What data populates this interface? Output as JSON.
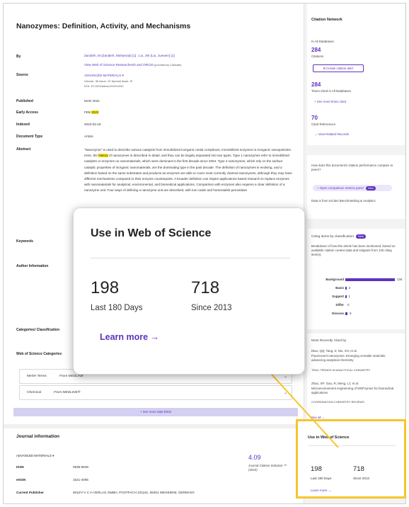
{
  "article": {
    "title": "Nanozymes: Definition, Activity, and Mechanisms",
    "by_label": "By",
    "authors_line": "Zandieh, M (Zandieh, Mohamad) [1] ; Liu, JW (Liu, Juewen) [1]",
    "researcherid_link": "View Web of Science ResearcherID and ORCID",
    "provided_by": "(provided by Clarivate)",
    "source_label": "Source",
    "source_journal": "ADVANCED MATERIALS",
    "source_details": "Volume: 36    Issue: 10    Special Issue: SI",
    "doi": "DOI: 10.1002/adma.202211041",
    "published_label": "Published",
    "published_value": "MAR 2024",
    "early_access_label": "Early Access",
    "early_access_month": "FEB",
    "early_access_year": "2023",
    "indexed_label": "Indexed",
    "indexed_value": "2023-03-18",
    "doctype_label": "Document Type",
    "doctype_value": "Article",
    "abstract_label": "Abstract",
    "abstract_pre": "\"Nanozyme\" is used to describe various catalysts from immobilized inorganic metal complexes, immobilized enzymes to inorganic nanoparticles. Here, the ",
    "abstract_hl": "history",
    "abstract_post": " of nanozymes is described in detail, and they can be largely separated into two types. Type 1 nanozymes refer to immobilized catalysts or enzymes on nanomaterials, which were dominant in the first decade since 2004. Type 2 nanozymes, which rely on the surface catalytic properties of inorganic nanomaterials, are the dominating type in the past decade. The definition of nanozymes is evolving, and a definition based on the same substrates and products as enzymes are able to cover most currently claimed nanozymes, although they may have different mechanisms compared to their enzyme counterparts. A broader definition can inspire applications based research to replace enzymes with nanomaterials for analytical, environmental, and biomedical applications. Comparison with enzymes also requires a clear definition of a nanozyme unit. Four ways of defining a nanozyme unit are described, with iron oxide and horseradish peroxidase",
    "keywords_label": "Keywords",
    "author_info_label": "Author Information",
    "categories_label": "Categories/ Classification",
    "wos_categories_label": "Web of Science Categories",
    "mesh_key": "MeSH Terms",
    "mesh_value": "From MEDLINE",
    "chemical_key": "Chemical",
    "chemical_value": "From MEDLINE®",
    "see_more": "+ See more data fields"
  },
  "journal": {
    "title": "Journal information",
    "journal_link": "ADVANCED MATERIALS",
    "issn_label": "ISSN",
    "issn_value": "0935-9648",
    "eissn_label": "eISSN",
    "eissn_value": "1521-4095",
    "publisher_label": "Current Publisher",
    "publisher_value": "WILEY-V C H VERLAG GMBH, POSTFACH 101161, 69451 WEINHEIM, GERMANY",
    "jci_value": "4.09",
    "jci_label": "Journal Citation Indicator ™ (2023)"
  },
  "sidebar": {
    "network_title": "Citation Network",
    "in_all_db": "In All Databases",
    "citations_num": "284",
    "citations_label": "Citations",
    "create_alert": "Create citation alert",
    "times_cited_num": "284",
    "times_cited_label": "Times Cited in All Databases",
    "see_more_times": "+ See more times cited",
    "cited_refs_num": "70",
    "cited_refs_label": "Cited References",
    "view_related": "→ View Related Records",
    "compare_question": "How does this document's citation performance compare to peers?",
    "open_panel": "Open comparison metrics panel",
    "new_badge": "New",
    "incites_note": "Data is from InCites Benchmarking & Analytics",
    "classification_title": "Citing items by classification",
    "classification_desc": "Breakdown of how this article has been mentioned, based on available citation context data and snippets from 140 citing item(s).",
    "bars": [
      {
        "label": "Background",
        "value": "134",
        "width": 32
      },
      {
        "label": "Basis",
        "value": "3",
        "width": 1.4
      },
      {
        "label": "Support",
        "value": "1",
        "width": 0.8
      },
      {
        "label": "Differ",
        "value": "0",
        "width": 0
      },
      {
        "label": "Discuss",
        "value": "6",
        "width": 1.8
      }
    ],
    "recent_title": "Most Recently Cited by",
    "recent": [
      {
        "authors": "Diao, QQ; Tang, Z; Niu, XH; et al.",
        "title": "Fluorescent nanozymes: Emerging versatile materials advancing analytical chemistry",
        "journal": "TRAC-TRENDS IN ANALYTICAL CHEMISTRY"
      },
      {
        "authors": "Zhao, XP; Gao, R; Meng, LJ; et al.",
        "title": "Microenvironment engineering of MOFzymes for biomedical applications",
        "journal": "COORDINATION CHEMISTRY REVIEWS"
      }
    ],
    "see_all": "See all →"
  },
  "use_in_wos": {
    "title": "Use in Web of Science",
    "last180_num": "198",
    "last180_label": "Last 180 Days",
    "since2013_num": "718",
    "since2013_label": "Since 2013",
    "learn_more": "Learn more →"
  },
  "colors": {
    "accent": "#5e33bf",
    "highlight_frame": "#f6c52a",
    "arrow": "#f6c52a"
  }
}
